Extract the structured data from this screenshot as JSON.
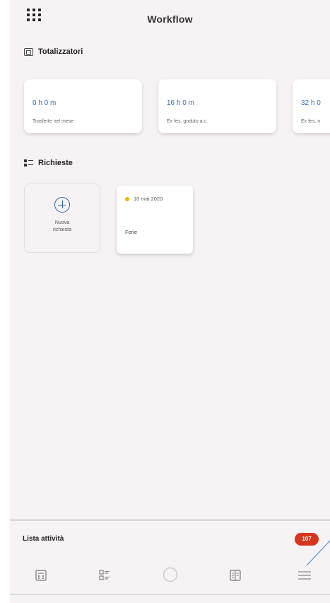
{
  "header": {
    "title": "Workflow",
    "menu_icon": "apps-grid-icon"
  },
  "totalizzatori": {
    "heading": "Totalizzatori",
    "icon": "calculator-icon",
    "cards": [
      {
        "value": "0 h 0 m",
        "label": "Trasferte nel mese"
      },
      {
        "value": "16 h 0 m",
        "label": "Ex fes. goduto a.c."
      },
      {
        "value": "32 h 0",
        "label": "Ex fes. n"
      }
    ]
  },
  "richieste": {
    "heading": "Richieste",
    "icon": "request-list-icon",
    "new_request": {
      "line1": "Nuova",
      "line2": "richiesta",
      "icon": "add-circle-icon"
    },
    "items": [
      {
        "date": "10 mai 2020",
        "type": "Ferie",
        "status_color": "#f2b705"
      }
    ]
  },
  "bottom_sheet": {
    "title": "Lista attività",
    "badge": "107",
    "badge_color": "#d6361e"
  },
  "tabbar": {
    "items": [
      {
        "icon": "calculator-icon"
      },
      {
        "icon": "request-list-icon"
      },
      {
        "icon": "circle-icon"
      },
      {
        "icon": "calendar-icon"
      },
      {
        "icon": "menu-icon"
      }
    ]
  },
  "accent_color": "#2f6fb3"
}
